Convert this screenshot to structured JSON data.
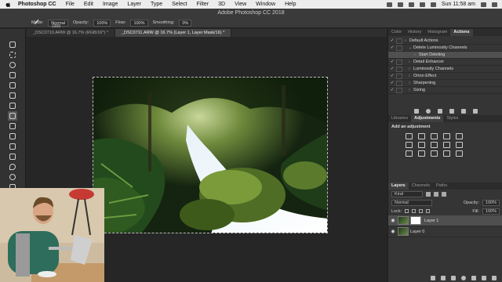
{
  "menubar": {
    "app": "Photoshop CC",
    "items": [
      "File",
      "Edit",
      "Image",
      "Layer",
      "Type",
      "Select",
      "Filter",
      "3D",
      "View",
      "Window",
      "Help"
    ],
    "clock": "Sun 11:58 am"
  },
  "window_title": "Adobe Photoshop CC 2018",
  "options": {
    "brush_size": "1300",
    "mode_label": "Mode:",
    "mode_value": "Normal",
    "opacity_label": "Opacity:",
    "opacity_value": "100%",
    "flow_label": "Flow:",
    "flow_value": "100%",
    "smoothing_label": "Smoothing:",
    "smoothing_value": "0%"
  },
  "tabs": [
    "_DSC0710.ARW @ 16.7% (RGB/16*) *",
    "_DSC0711.ARW @ 16.7% (Layer 1, Layer Mask/16) *"
  ],
  "panels": {
    "top_tabs": [
      "Color",
      "History",
      "Histogram",
      "Actions"
    ],
    "actions": [
      {
        "label": "Default Actions",
        "check": "✓",
        "indent": 0,
        "expanded": false
      },
      {
        "label": "Delete Luminosity Channels",
        "check": "✓",
        "indent": 1,
        "expanded": true
      },
      {
        "label": "Start Deleting",
        "check": "",
        "indent": 2,
        "expanded": false
      },
      {
        "label": "Detail Enhancer",
        "check": "✓",
        "indent": 1,
        "expanded": false
      },
      {
        "label": "Luminosity Channels",
        "check": "✓",
        "indent": 1,
        "expanded": false
      },
      {
        "label": "Orton Effect",
        "check": "✓",
        "indent": 1,
        "expanded": false
      },
      {
        "label": "Sharpening",
        "check": "✓",
        "indent": 1,
        "expanded": false
      },
      {
        "label": "Sizing",
        "check": "✓",
        "indent": 1,
        "expanded": false
      }
    ],
    "mid_tabs": [
      "Libraries",
      "Adjustments",
      "Styles"
    ],
    "adj_title": "Add an adjustment",
    "layer_tabs": [
      "Layers",
      "Channels",
      "Paths"
    ],
    "kind_label": "Kind",
    "blend_mode": "Normal",
    "opacity_label": "Opacity:",
    "opacity_value": "100%",
    "lock_label": "Lock:",
    "fill_label": "Fill:",
    "fill_value": "100%",
    "layers": [
      {
        "name": "Layer 1",
        "mask": true
      },
      {
        "name": "Layer 0",
        "mask": false
      }
    ]
  }
}
